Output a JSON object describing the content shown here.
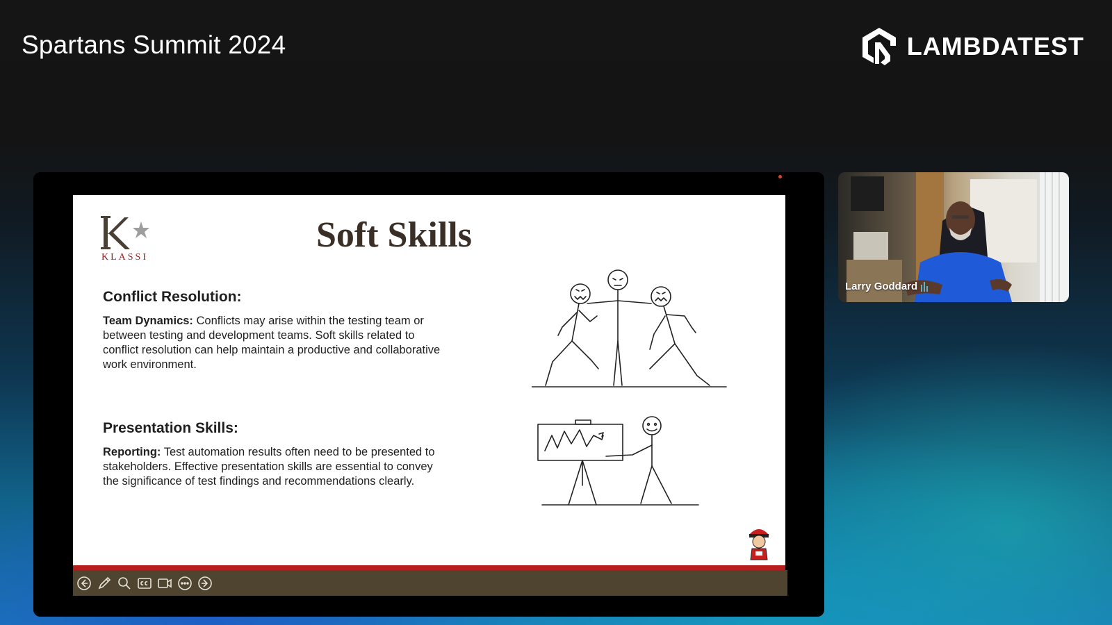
{
  "header": {
    "event_title": "Spartans Summit 2024",
    "brand_name": "LAMBDATEST"
  },
  "slide": {
    "logo_text": "KLASSI",
    "title": "Soft Skills",
    "sections": [
      {
        "heading": "Conflict Resolution:",
        "lead": "Team Dynamics:",
        "text": "Conflicts may arise within the testing team or between testing and development teams. Soft skills related to conflict resolution can help maintain a productive and collaborative work environment."
      },
      {
        "heading": "Presentation Skills:",
        "lead": "Reporting:",
        "text": "Test automation results often need to be presented to stakeholders. Effective presentation skills are essential to convey the significance of test findings and recommendations clearly."
      }
    ]
  },
  "controls": [
    "previous-slide",
    "pen",
    "zoom",
    "captions",
    "camera",
    "more-options",
    "next-slide"
  ],
  "presenter": {
    "name": "Larry Goddard"
  },
  "colors": {
    "slide_red_bar": "#b61d1d",
    "control_bar": "#4e4430",
    "title_brown": "#3a2f26",
    "logo_red": "#9b1b1b"
  }
}
